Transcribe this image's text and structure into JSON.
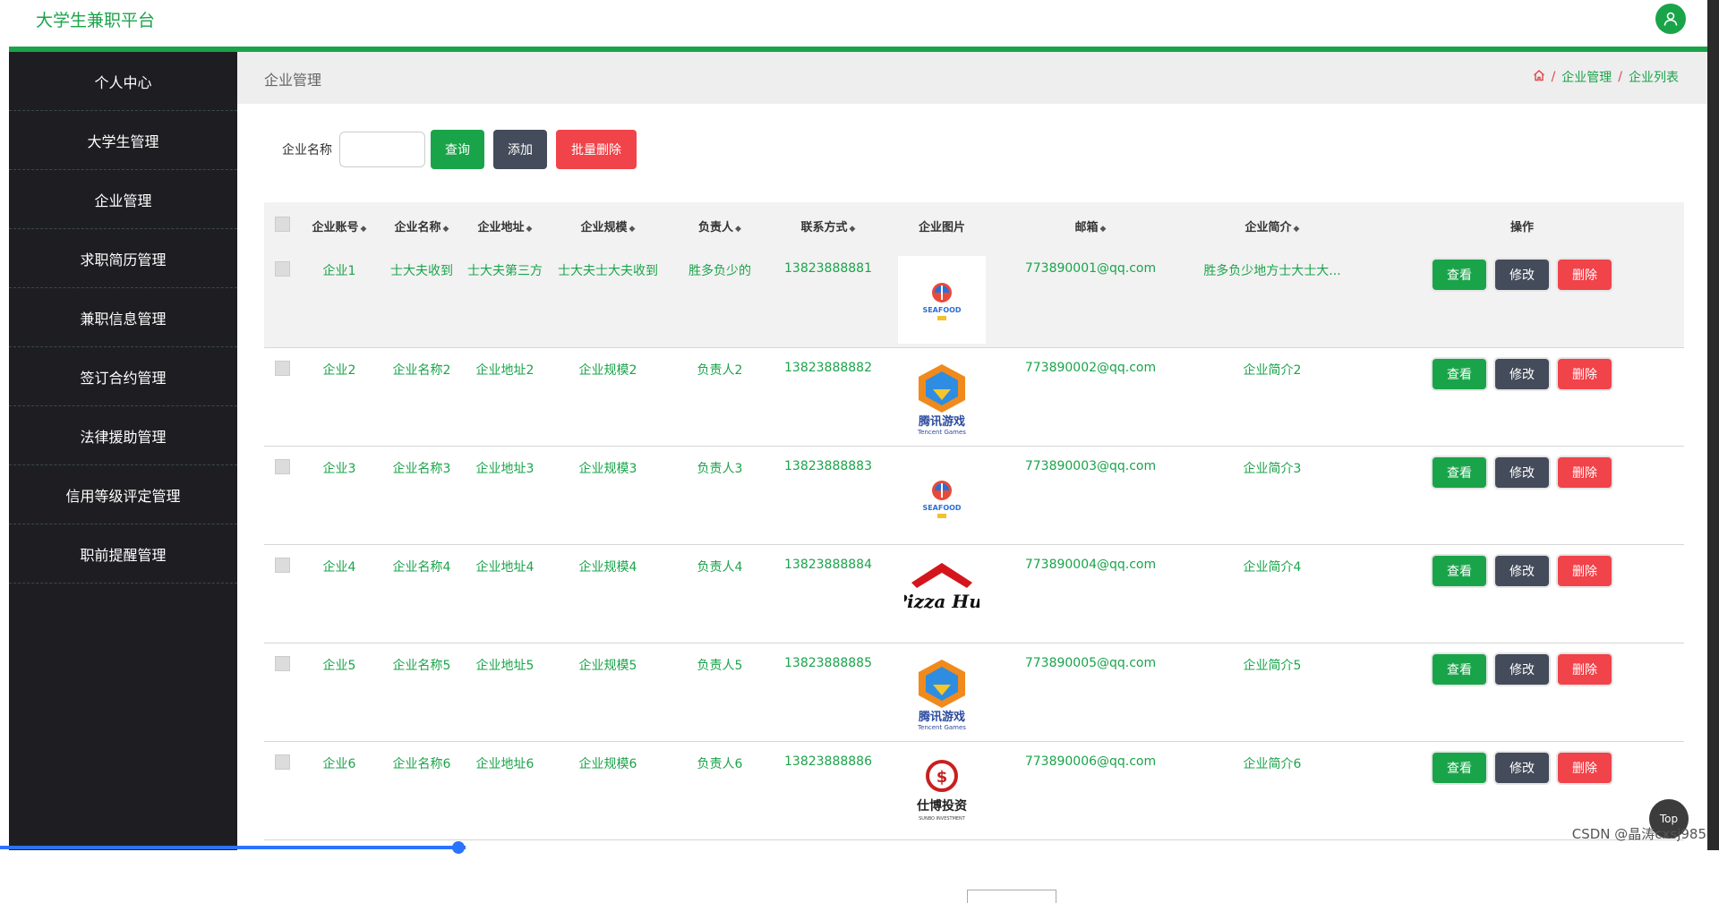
{
  "app": {
    "title": "大学生兼职平台"
  },
  "sidebar": {
    "items": [
      {
        "label": "个人中心"
      },
      {
        "label": "大学生管理"
      },
      {
        "label": "企业管理"
      },
      {
        "label": "求职简历管理"
      },
      {
        "label": "兼职信息管理"
      },
      {
        "label": "签订合约管理"
      },
      {
        "label": "法律援助管理"
      },
      {
        "label": "信用等级评定管理"
      },
      {
        "label": "职前提醒管理"
      }
    ]
  },
  "page": {
    "title": "企业管理",
    "breadcrumb": [
      {
        "label": "企业管理"
      },
      {
        "label": "企业列表"
      }
    ]
  },
  "search": {
    "label": "企业名称",
    "input_value": "",
    "query_label": "查询",
    "add_label": "添加",
    "batch_delete_label": "批量删除"
  },
  "table": {
    "columns": [
      "企业账号",
      "企业名称",
      "企业地址",
      "企业规模",
      "负责人",
      "联系方式",
      "企业图片",
      "邮箱",
      "企业简介",
      "操作"
    ],
    "actions": {
      "view": "查看",
      "edit": "修改",
      "delete": "删除"
    },
    "rows": [
      {
        "account": "企业1",
        "name": "士大夫收到",
        "address": "士大夫第三方",
        "scale": "士大夫士大夫收到",
        "manager": "胜多负少的",
        "phone": "13823888881",
        "logo": "seafood",
        "email": "773890001@qq.com",
        "intro": "胜多负少地方士大士大..."
      },
      {
        "account": "企业2",
        "name": "企业名称2",
        "address": "企业地址2",
        "scale": "企业规模2",
        "manager": "负责人2",
        "phone": "13823888882",
        "logo": "tencent-games",
        "email": "773890002@qq.com",
        "intro": "企业简介2"
      },
      {
        "account": "企业3",
        "name": "企业名称3",
        "address": "企业地址3",
        "scale": "企业规模3",
        "manager": "负责人3",
        "phone": "13823888883",
        "logo": "seafood",
        "email": "773890003@qq.com",
        "intro": "企业简介3"
      },
      {
        "account": "企业4",
        "name": "企业名称4",
        "address": "企业地址4",
        "scale": "企业规模4",
        "manager": "负责人4",
        "phone": "13823888884",
        "logo": "pizza-hut",
        "email": "773890004@qq.com",
        "intro": "企业简介4"
      },
      {
        "account": "企业5",
        "name": "企业名称5",
        "address": "企业地址5",
        "scale": "企业规模5",
        "manager": "负责人5",
        "phone": "13823888885",
        "logo": "tencent-games",
        "email": "773890005@qq.com",
        "intro": "企业简介5"
      },
      {
        "account": "企业6",
        "name": "企业名称6",
        "address": "企业地址6",
        "scale": "企业规模6",
        "manager": "负责人6",
        "phone": "13823888886",
        "logo": "shibo-investment",
        "email": "773890006@qq.com",
        "intro": "企业简介6"
      }
    ]
  },
  "logo_text": {
    "seafood": "SEAFOOD",
    "tencent": "腾讯游戏",
    "tencent_en": "Tencent Games",
    "pizza_hut": "Pizza Hut",
    "shibo": "仕博投资",
    "shibo_en": "SUNBO INVESTMENT"
  },
  "top_button": "Top",
  "watermark": "CSDN @晶涛cxsj985",
  "colors": {
    "accent": "#1aa44a",
    "danger": "#f0434a",
    "dark": "#444b5a",
    "sidebar": "#1e1e22"
  }
}
